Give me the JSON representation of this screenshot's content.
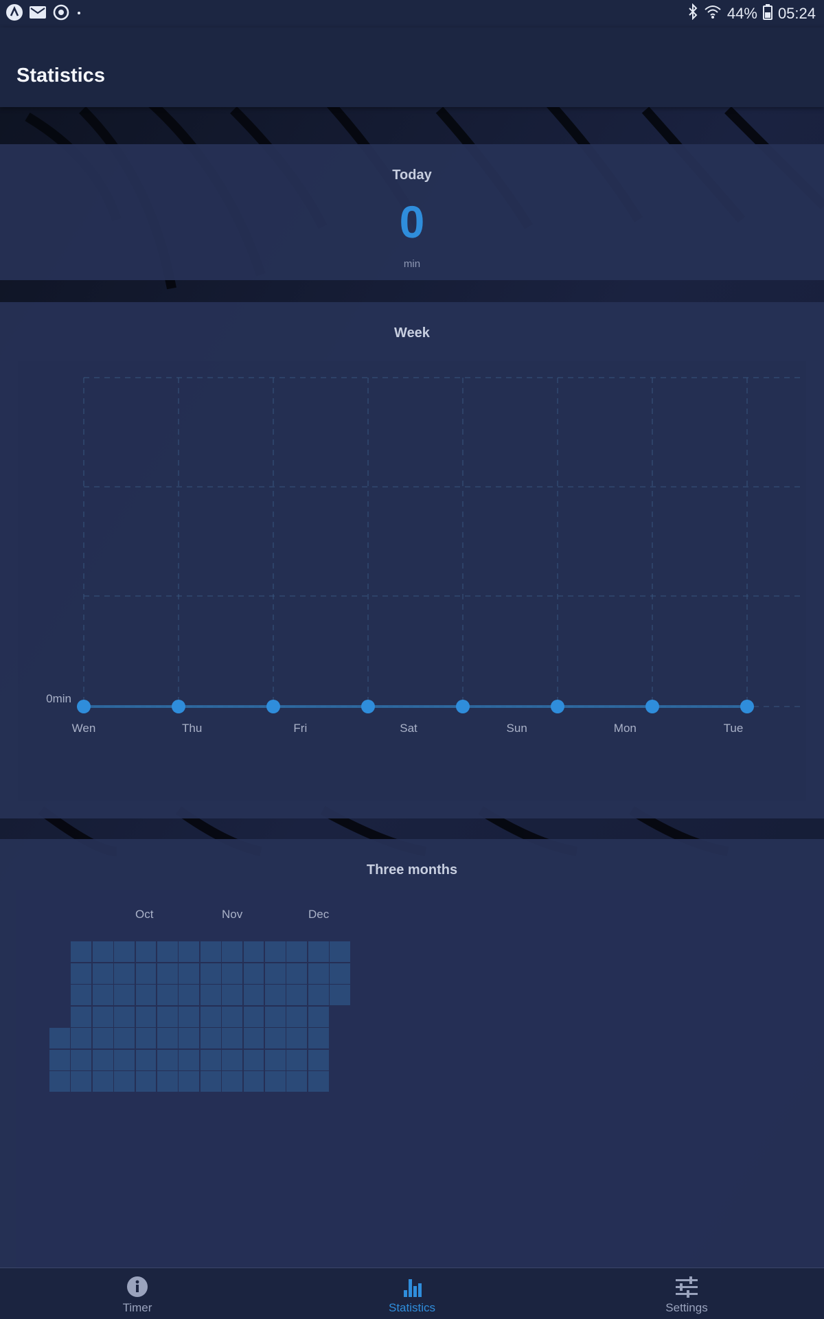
{
  "status_bar": {
    "battery": "44%",
    "time": "05:24",
    "left_icons": [
      "app-launcher-icon",
      "email-icon",
      "sync-icon",
      "dot-icon"
    ],
    "right_icons": [
      "bluetooth-icon",
      "wifi-icon",
      "battery-icon"
    ]
  },
  "app_bar": {
    "title": "Statistics"
  },
  "today": {
    "title": "Today",
    "value": "0",
    "unit": "min"
  },
  "week": {
    "title": "Week"
  },
  "three_months": {
    "title": "Three months",
    "month_labels": [
      "Oct",
      "Nov",
      "Dec"
    ]
  },
  "colors": {
    "accent": "#2f8ddb",
    "card_bg": "#273156",
    "heat_cell": "#2b4a78",
    "nav_inactive": "#9aa3bd"
  },
  "chart_data": [
    {
      "type": "line",
      "title": "Week",
      "categories": [
        "Wen",
        "Thu",
        "Fri",
        "Sat",
        "Sun",
        "Mon",
        "Tue"
      ],
      "series": [
        {
          "values": [
            0,
            0,
            0,
            0,
            0,
            0,
            0,
            0
          ]
        }
      ],
      "y_tick_labels": [
        "0min"
      ],
      "grid": true,
      "dashed_grid": true
    },
    {
      "type": "heatmap",
      "title": "Three months",
      "x_labels": [
        "Oct",
        "Nov",
        "Dec"
      ],
      "columns": 14,
      "rows": 7,
      "column_row_ranges": [
        [
          4,
          6
        ],
        [
          0,
          6
        ],
        [
          0,
          6
        ],
        [
          0,
          6
        ],
        [
          0,
          6
        ],
        [
          0,
          6
        ],
        [
          0,
          6
        ],
        [
          0,
          6
        ],
        [
          0,
          6
        ],
        [
          0,
          6
        ],
        [
          0,
          6
        ],
        [
          0,
          6
        ],
        [
          0,
          6
        ],
        [
          0,
          2
        ]
      ],
      "values_all": 0
    }
  ],
  "bottom_nav": {
    "items": [
      {
        "label": "Timer",
        "icon": "info-icon",
        "active": false
      },
      {
        "label": "Statistics",
        "icon": "bar-chart-icon",
        "active": true
      },
      {
        "label": "Settings",
        "icon": "sliders-icon",
        "active": false
      }
    ]
  }
}
